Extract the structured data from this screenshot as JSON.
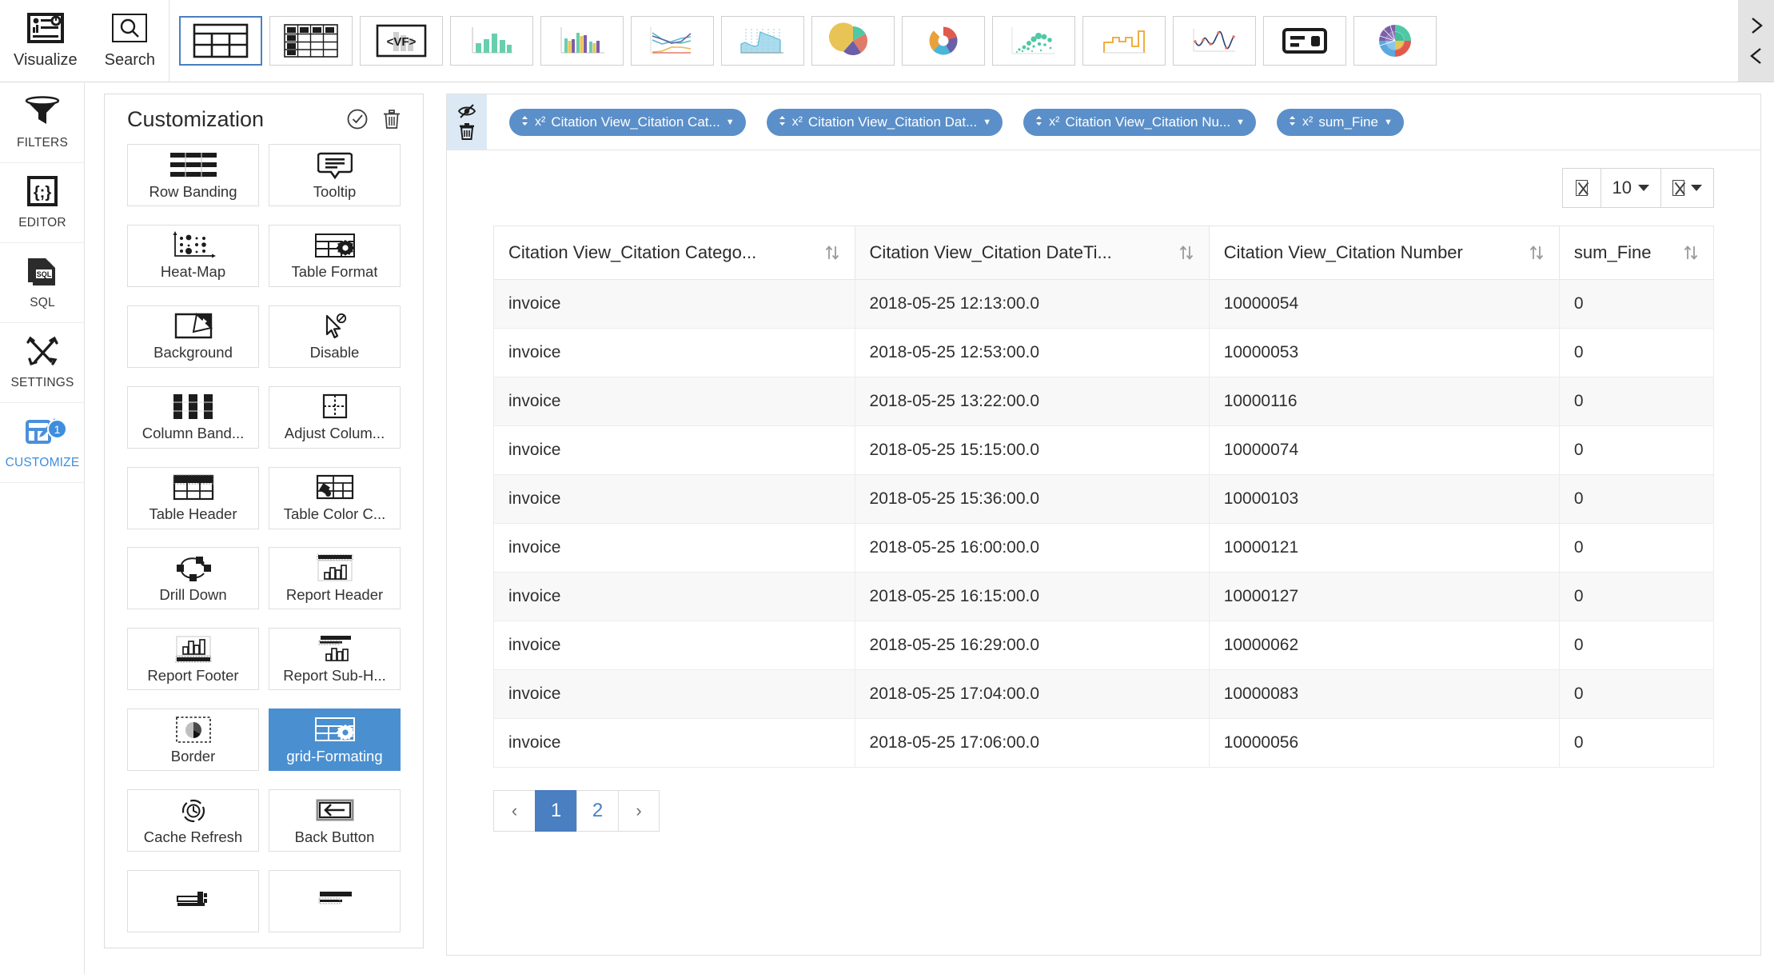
{
  "topbar": {
    "left_items": [
      {
        "label": "Visualize",
        "icon": "visualize-icon"
      },
      {
        "label": "Search",
        "icon": "search-icon"
      }
    ],
    "chart_types": [
      {
        "name": "table",
        "selected": true
      },
      {
        "name": "pivot-table",
        "selected": false
      },
      {
        "name": "velocity-format",
        "selected": false
      },
      {
        "name": "bar-chart",
        "selected": false
      },
      {
        "name": "grouped-bar-chart",
        "selected": false
      },
      {
        "name": "line-chart",
        "selected": false
      },
      {
        "name": "area-chart",
        "selected": false
      },
      {
        "name": "pie-chart",
        "selected": false
      },
      {
        "name": "donut-chart",
        "selected": false
      },
      {
        "name": "bubble-chart",
        "selected": false
      },
      {
        "name": "step-chart",
        "selected": false
      },
      {
        "name": "spline-chart",
        "selected": false
      },
      {
        "name": "kpi-card",
        "selected": false
      },
      {
        "name": "sunburst-chart",
        "selected": false
      }
    ],
    "nav_next": "next-icon",
    "nav_prev": "prev-icon"
  },
  "rail": {
    "items": [
      {
        "label": "FILTERS",
        "icon": "filter-icon",
        "active": false,
        "badge": null
      },
      {
        "label": "EDITOR",
        "icon": "editor-icon",
        "active": false,
        "badge": null
      },
      {
        "label": "SQL",
        "icon": "sql-icon",
        "active": false,
        "badge": null
      },
      {
        "label": "SETTINGS",
        "icon": "settings-icon",
        "active": false,
        "badge": null
      },
      {
        "label": "CUSTOMIZE",
        "icon": "customize-icon",
        "active": true,
        "badge": "1"
      }
    ]
  },
  "customization": {
    "title": "Customization",
    "apply_icon": "check-circle-icon",
    "delete_icon": "trash-icon",
    "cards": [
      {
        "label": "Row Banding",
        "icon": "row-banding-icon",
        "selected": false
      },
      {
        "label": "Tooltip",
        "icon": "tooltip-icon",
        "selected": false
      },
      {
        "label": "Heat-Map",
        "icon": "heatmap-icon",
        "selected": false
      },
      {
        "label": "Table Format",
        "icon": "table-format-icon",
        "selected": false
      },
      {
        "label": "Background",
        "icon": "background-icon",
        "selected": false
      },
      {
        "label": "Disable",
        "icon": "disable-cursor-icon",
        "selected": false
      },
      {
        "label": "Column Band...",
        "icon": "column-banding-icon",
        "selected": false
      },
      {
        "label": "Adjust Colum...",
        "icon": "adjust-column-icon",
        "selected": false
      },
      {
        "label": "Table Header",
        "icon": "table-header-icon",
        "selected": false
      },
      {
        "label": "Table Color C...",
        "icon": "table-color-icon",
        "selected": false
      },
      {
        "label": "Drill Down",
        "icon": "drill-down-icon",
        "selected": false
      },
      {
        "label": "Report Header",
        "icon": "report-header-icon",
        "selected": false
      },
      {
        "label": "Report Footer",
        "icon": "report-footer-icon",
        "selected": false
      },
      {
        "label": "Report Sub-H...",
        "icon": "report-subheader-icon",
        "selected": false
      },
      {
        "label": "Border",
        "icon": "border-icon",
        "selected": false
      },
      {
        "label": "grid-Formating",
        "icon": "grid-formatting-icon",
        "selected": true
      },
      {
        "label": "Cache Refresh",
        "icon": "cache-refresh-icon",
        "selected": false
      },
      {
        "label": "Back Button",
        "icon": "back-button-icon",
        "selected": false
      }
    ]
  },
  "main": {
    "tools": {
      "hide_icon": "eye-slash-icon",
      "delete_icon": "trash-icon"
    },
    "pills": [
      {
        "label": "Citation View_Citation Cat...",
        "prefix": "x²"
      },
      {
        "label": "Citation View_Citation Dat...",
        "prefix": "x²"
      },
      {
        "label": "Citation View_Citation Nu...",
        "prefix": "x²"
      },
      {
        "label": "sum_Fine",
        "prefix": "x²"
      }
    ],
    "grid_toolbar": {
      "export_icon": "missing-glyph",
      "page_size": "10",
      "settings_icon": "missing-glyph"
    },
    "table": {
      "columns": [
        {
          "label": "Citation View_Citation Catego...",
          "sortable": true
        },
        {
          "label": "Citation View_Citation DateTi...",
          "sortable": true
        },
        {
          "label": "Citation View_Citation Number",
          "sortable": true
        },
        {
          "label": "sum_Fine",
          "sortable": true
        }
      ],
      "rows": [
        [
          "invoice",
          "2018-05-25 12:13:00.0",
          "10000054",
          "0"
        ],
        [
          "invoice",
          "2018-05-25 12:53:00.0",
          "10000053",
          "0"
        ],
        [
          "invoice",
          "2018-05-25 13:22:00.0",
          "10000116",
          "0"
        ],
        [
          "invoice",
          "2018-05-25 15:15:00.0",
          "10000074",
          "0"
        ],
        [
          "invoice",
          "2018-05-25 15:36:00.0",
          "10000103",
          "0"
        ],
        [
          "invoice",
          "2018-05-25 16:00:00.0",
          "10000121",
          "0"
        ],
        [
          "invoice",
          "2018-05-25 16:15:00.0",
          "10000127",
          "0"
        ],
        [
          "invoice",
          "2018-05-25 16:29:00.0",
          "10000062",
          "0"
        ],
        [
          "invoice",
          "2018-05-25 17:04:00.0",
          "10000083",
          "0"
        ],
        [
          "invoice",
          "2018-05-25 17:06:00.0",
          "10000056",
          "0"
        ]
      ]
    },
    "pagination": {
      "prev": "‹",
      "next": "›",
      "pages": [
        "1",
        "2"
      ],
      "current": "1"
    }
  },
  "colors": {
    "accent": "#4a7fc1",
    "pill": "#5b8fc9",
    "selected_card": "#4a8fd0",
    "rail_active": "#3e8ede",
    "pill_strip": "#dce9f5"
  }
}
